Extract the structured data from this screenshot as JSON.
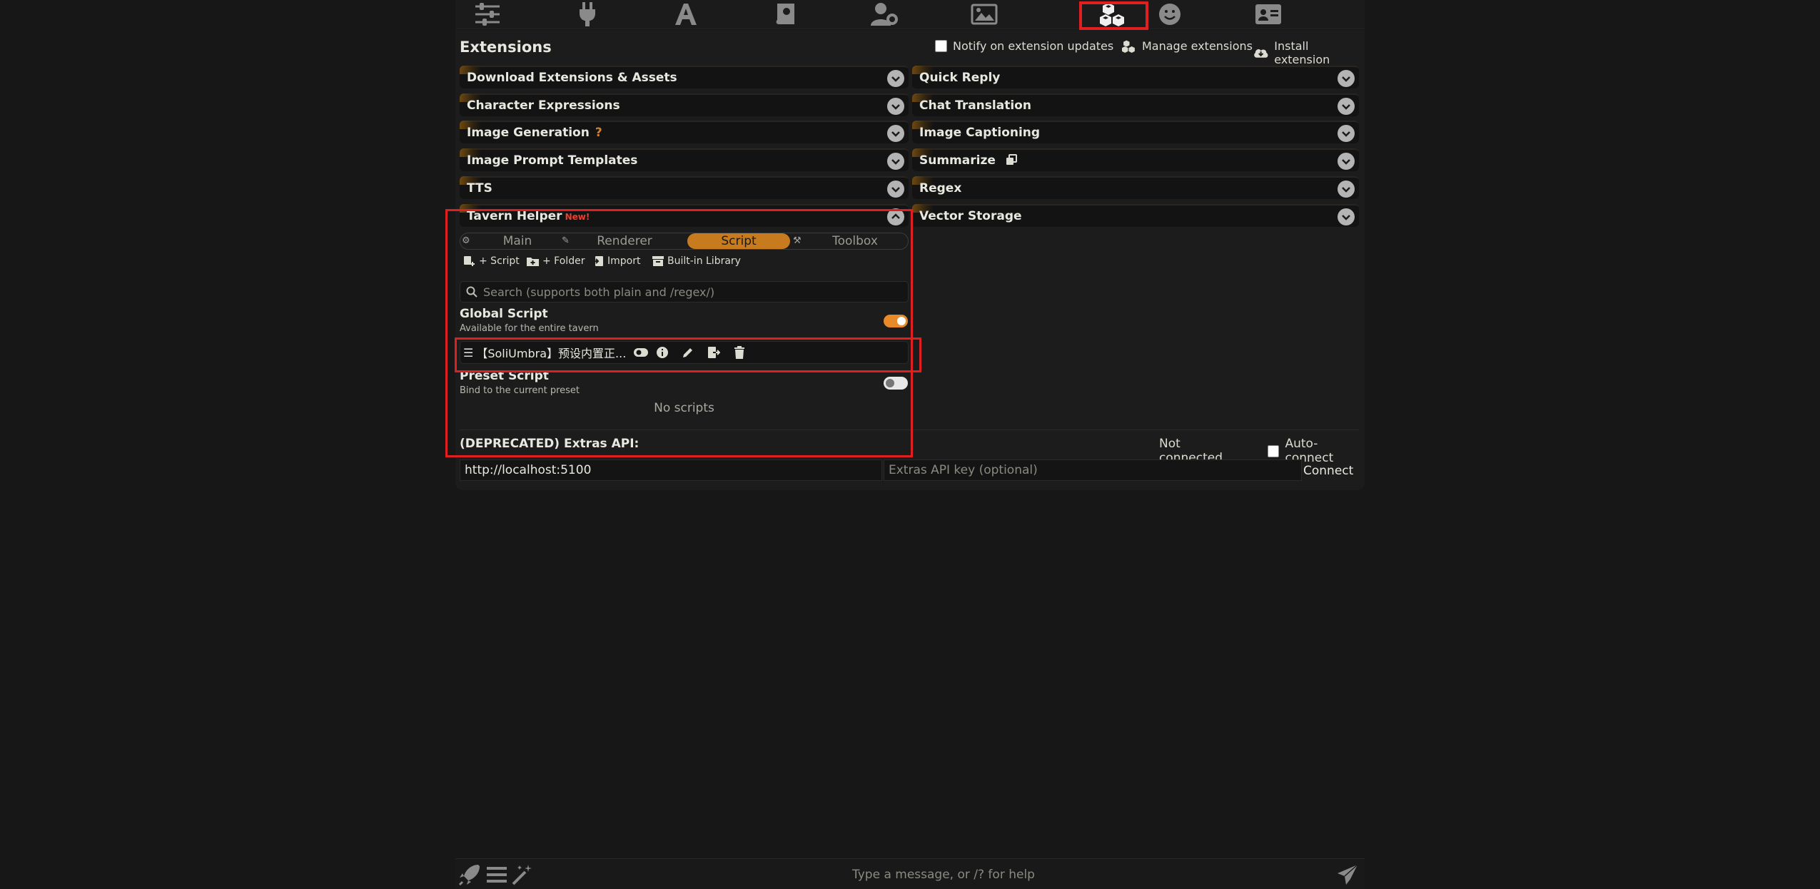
{
  "topbar": {
    "icons": [
      "sliders-icon",
      "plug-icon",
      "font-icon",
      "book-icon",
      "user-gear-icon",
      "image-icon",
      "cubes-icon",
      "smile-icon",
      "id-card-icon"
    ],
    "active": "cubes-icon"
  },
  "extensions": {
    "title": "Extensions",
    "notify_label": "Notify on extension updates",
    "manage_label": "Manage extensions",
    "install_label": "Install extension"
  },
  "left_drawers": [
    {
      "label": "Download Extensions & Assets"
    },
    {
      "label": "Character Expressions"
    },
    {
      "label": "Image Generation",
      "tag": "?"
    },
    {
      "label": "Image Prompt Templates"
    },
    {
      "label": "TTS"
    },
    {
      "label": "Tavern Helper",
      "tag": "New!"
    }
  ],
  "right_drawers": [
    {
      "label": "Quick Reply"
    },
    {
      "label": "Chat Translation"
    },
    {
      "label": "Image Captioning"
    },
    {
      "label": "Summarize"
    },
    {
      "label": "Regex"
    },
    {
      "label": "Vector Storage"
    }
  ],
  "tavern_helper": {
    "tabs": [
      {
        "label": "Main"
      },
      {
        "label": "Renderer"
      },
      {
        "label": "Script",
        "active": true
      },
      {
        "label": "Toolbox"
      }
    ],
    "toolbar": {
      "add_script": "+ Script",
      "add_folder": "+ Folder",
      "import": "Import",
      "library": "Built-in Library"
    },
    "search_placeholder": "Search (supports both plain and /regex/)",
    "global": {
      "title": "Global Script",
      "subtitle": "Available for the entire tavern",
      "enabled": true
    },
    "script_item": {
      "name": "【SoliUmbra】预设内置正..."
    },
    "preset": {
      "title": "Preset Script",
      "subtitle": "Bind to the current preset",
      "enabled": false,
      "empty_text": "No scripts"
    }
  },
  "extras": {
    "title": "(DEPRECATED) Extras API:",
    "status": "Not connected...",
    "autoconnect_label": "Auto-connect",
    "url_value": "http://localhost:5100",
    "key_placeholder": "Extras API key (optional)",
    "connect_label": "Connect"
  },
  "bottom": {
    "message_placeholder": "Type a message, or /? for help"
  },
  "colors": {
    "accent": "#c77a1e",
    "highlight": "#e02020",
    "new_tag": "#e84030"
  }
}
